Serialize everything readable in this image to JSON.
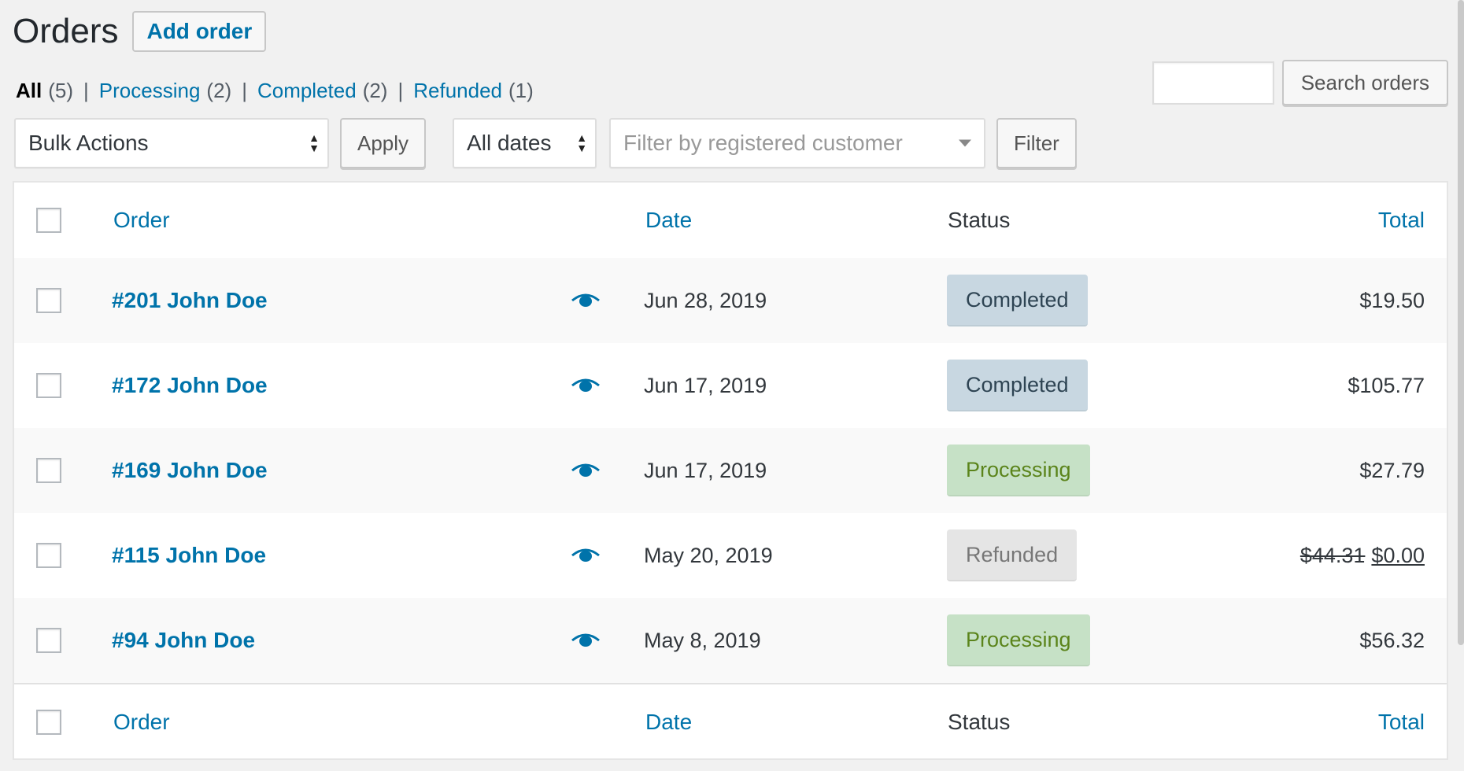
{
  "page": {
    "title": "Orders",
    "add_order_label": "Add order"
  },
  "filters": {
    "views": [
      {
        "label": "All",
        "count": "(5)"
      },
      {
        "label": "Processing",
        "count": "(2)"
      },
      {
        "label": "Completed",
        "count": "(2)"
      },
      {
        "label": "Refunded",
        "count": "(1)"
      }
    ],
    "separator": "|",
    "search_placeholder": "",
    "search_button": "Search orders",
    "bulk_actions": "Bulk Actions",
    "apply_button": "Apply",
    "dates": "All dates",
    "customer_placeholder": "Filter by registered customer",
    "filter_button": "Filter"
  },
  "table": {
    "headers": {
      "order": "Order",
      "date": "Date",
      "status": "Status",
      "total": "Total"
    },
    "rows": [
      {
        "order": "#201 John Doe",
        "date": "Jun 28, 2019",
        "status": "Completed",
        "total": "$19.50",
        "old_total": ""
      },
      {
        "order": "#172 John Doe",
        "date": "Jun 17, 2019",
        "status": "Completed",
        "total": "$105.77",
        "old_total": ""
      },
      {
        "order": "#169 John Doe",
        "date": "Jun 17, 2019",
        "status": "Processing",
        "total": "$27.79",
        "old_total": ""
      },
      {
        "order": "#115 John Doe",
        "date": "May 20, 2019",
        "status": "Refunded",
        "total": "$0.00",
        "old_total": "$44.31"
      },
      {
        "order": "#94 John Doe",
        "date": "May 8, 2019",
        "status": "Processing",
        "total": "$56.32",
        "old_total": ""
      }
    ]
  },
  "icons": {
    "preview": "eye-icon",
    "select_arrows": "up-down-arrows-icon",
    "dropdown": "caret-down-icon"
  },
  "colors": {
    "link": "#0073aa",
    "completed_bg": "#c8d7e1",
    "completed_text": "#2e4453",
    "processing_bg": "#c6e1c6",
    "processing_text": "#5b841b",
    "refunded_bg": "#e5e5e5",
    "refunded_text": "#777777"
  }
}
